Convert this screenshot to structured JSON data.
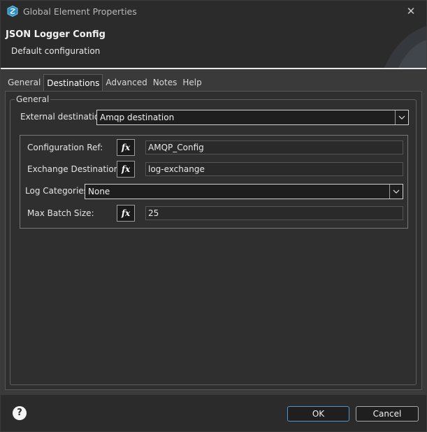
{
  "window": {
    "title": "Global Element Properties",
    "close_glyph": "✕"
  },
  "banner": {
    "title": "JSON Logger Config",
    "subtitle": "Default configuration"
  },
  "tabs": [
    {
      "label": "General",
      "active": false
    },
    {
      "label": "Destinations",
      "active": true
    },
    {
      "label": "Advanced",
      "active": false
    },
    {
      "label": "Notes",
      "active": false
    },
    {
      "label": "Help",
      "active": false
    }
  ],
  "group": {
    "label": "General",
    "external_destination": {
      "label": "External destination",
      "value": "Amqp destination"
    },
    "configuration_ref": {
      "label": "Configuration Ref:",
      "fx": "fx",
      "value": "AMQP_Config"
    },
    "exchange_destination": {
      "label": "Exchange Destination:",
      "fx": "fx",
      "value": "log-exchange"
    },
    "log_categories": {
      "label": "Log Categories",
      "value": "None"
    },
    "max_batch_size": {
      "label": "Max Batch Size:",
      "fx": "fx",
      "value": "25"
    }
  },
  "footer": {
    "help_glyph": "?",
    "ok_label": "OK",
    "cancel_label": "Cancel"
  },
  "colors": {
    "accent_border": "#5a8fd0",
    "app_icon": "#2ea3d6"
  }
}
